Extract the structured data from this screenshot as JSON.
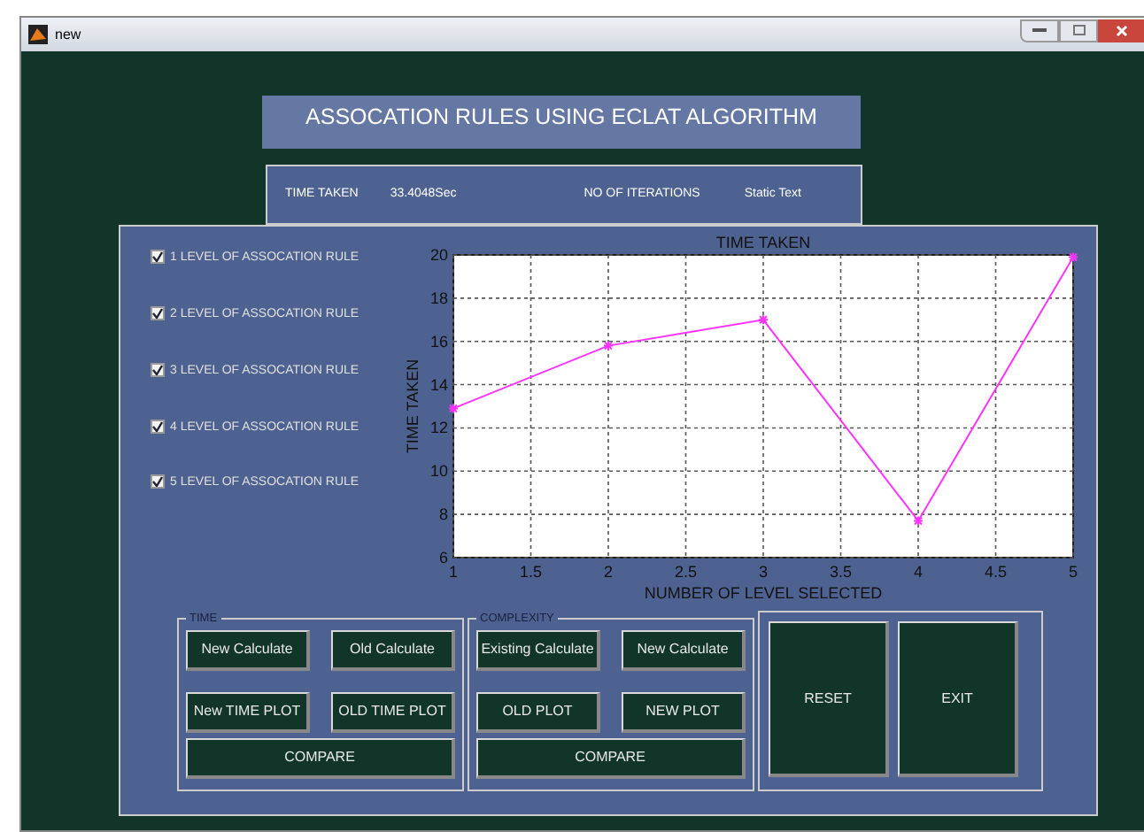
{
  "window": {
    "title": "new"
  },
  "header": {
    "title": "ASSOCATION RULES USING ECLAT ALGORITHM"
  },
  "info": [
    {
      "label": "TIME TAKEN",
      "value": "33.4048Sec"
    },
    {
      "label": "NO OF ITERATIONS",
      "value": "Static Text"
    }
  ],
  "levels": [
    {
      "label": "1 LEVEL OF ASSOCATION RULE",
      "checked": true
    },
    {
      "label": "2 LEVEL OF ASSOCATION RULE",
      "checked": true
    },
    {
      "label": "3 LEVEL OF ASSOCATION RULE",
      "checked": true
    },
    {
      "label": "4 LEVEL OF ASSOCATION RULE",
      "checked": true
    },
    {
      "label": "5 LEVEL OF ASSOCATION RULE",
      "checked": true
    }
  ],
  "chart_data": {
    "type": "line",
    "title": "TIME TAKEN",
    "xlabel": "NUMBER OF LEVEL SELECTED",
    "ylabel": "TIME TAKEN",
    "x": [
      1,
      2,
      3,
      4,
      5
    ],
    "grid": true,
    "series": [
      {
        "color": "#ff33ff",
        "marker": "cross",
        "values": [
          12.9,
          15.8,
          17,
          7.7,
          19.9
        ]
      }
    ],
    "xlim": [
      1,
      5
    ],
    "ylim": [
      6,
      20
    ],
    "xticks": [
      1,
      1.5,
      2,
      2.5,
      3,
      3.5,
      4,
      4.5,
      5
    ],
    "yticks": [
      6,
      8,
      10,
      12,
      14,
      16,
      18,
      20
    ]
  },
  "groups": [
    {
      "title": "TIME",
      "buttons": [
        "New Calculate",
        "Old Calculate",
        "New TIME PLOT",
        "OLD TIME PLOT"
      ],
      "wide_button": "COMPARE"
    },
    {
      "title": "COMPLEXITY",
      "buttons": [
        "Existing Calculate",
        "New Calculate",
        "OLD  PLOT",
        "NEW  PLOT"
      ],
      "wide_button": "COMPARE"
    }
  ],
  "actions": [
    "RESET",
    "EXIT"
  ]
}
